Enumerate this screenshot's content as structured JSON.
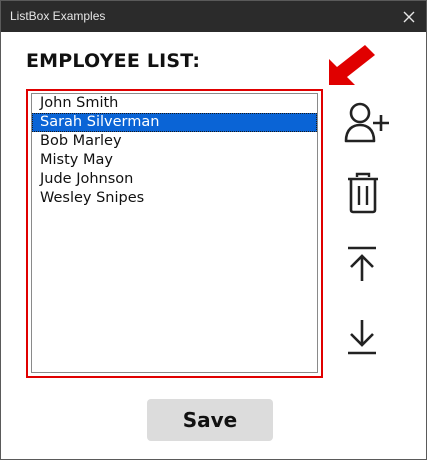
{
  "window": {
    "title": "ListBox Examples"
  },
  "heading": "EMPLOYEE LIST:",
  "listbox": {
    "items": [
      {
        "label": "John Smith"
      },
      {
        "label": "Sarah Silverman",
        "selected": true
      },
      {
        "label": "Bob Marley"
      },
      {
        "label": "Misty May"
      },
      {
        "label": "Jude Johnson"
      },
      {
        "label": "Wesley Snipes"
      }
    ],
    "border_color": "#e00000",
    "selection_color": "#0a64d6"
  },
  "toolbar": {
    "icons": [
      "add-user-icon",
      "trash-icon",
      "move-top-icon",
      "download-icon"
    ]
  },
  "save_label": "Save",
  "colors": {
    "titlebar": "#2b2b2b",
    "arrow": "#e00000",
    "save_bg": "#dcdcdc"
  }
}
